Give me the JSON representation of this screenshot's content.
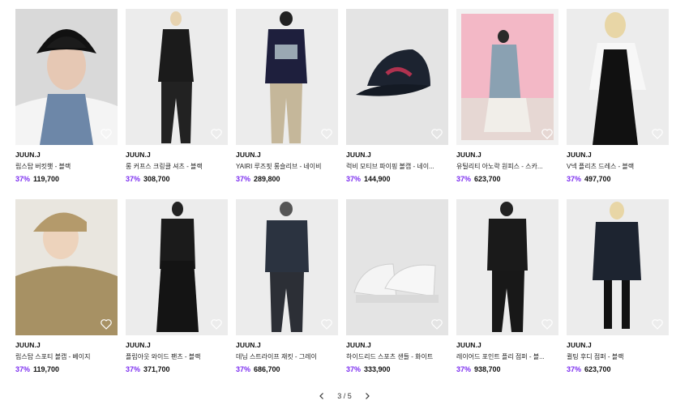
{
  "products": [
    {
      "brand": "JUUN.J",
      "name": "립스탑 버킷햇 - 블랙",
      "discount": "37%",
      "price": "119,700"
    },
    {
      "brand": "JUUN.J",
      "name": "롱 커프스 크링클 셔츠 - 블랙",
      "discount": "37%",
      "price": "308,700"
    },
    {
      "brand": "JUUN.J",
      "name": "YAIRI 루즈핏 롱슬리브 - 네이비",
      "discount": "37%",
      "price": "289,800"
    },
    {
      "brand": "JUUN.J",
      "name": "럭비 모티브 파이핑 볼캡 - 네이...",
      "discount": "37%",
      "price": "144,900"
    },
    {
      "brand": "JUUN.J",
      "name": "유틸리티 아노락 원피스 - 스카...",
      "discount": "37%",
      "price": "623,700"
    },
    {
      "brand": "JUUN.J",
      "name": "V넥 플리츠 드레스 - 블랙",
      "discount": "37%",
      "price": "497,700"
    },
    {
      "brand": "JUUN.J",
      "name": "립스탑 스포티 볼캡 - 베이지",
      "discount": "37%",
      "price": "119,700"
    },
    {
      "brand": "JUUN.J",
      "name": "플립아웃 와이드 팬츠 - 블랙",
      "discount": "37%",
      "price": "371,700"
    },
    {
      "brand": "JUUN.J",
      "name": "데님 스트라이프 재킷 - 그레이",
      "discount": "37%",
      "price": "686,700"
    },
    {
      "brand": "JUUN.J",
      "name": "하이드리드 스포츠 샌들 - 화이트",
      "discount": "37%",
      "price": "333,900"
    },
    {
      "brand": "JUUN.J",
      "name": "레이어드 포인트 플리 점퍼 - 블...",
      "discount": "37%",
      "price": "938,700"
    },
    {
      "brand": "JUUN.J",
      "name": "퀼팅 후디 점퍼 - 블랙",
      "discount": "37%",
      "price": "623,700"
    }
  ],
  "pagination": {
    "label": "3 / 5"
  },
  "colors": {
    "discount": "#7b2cf0"
  }
}
